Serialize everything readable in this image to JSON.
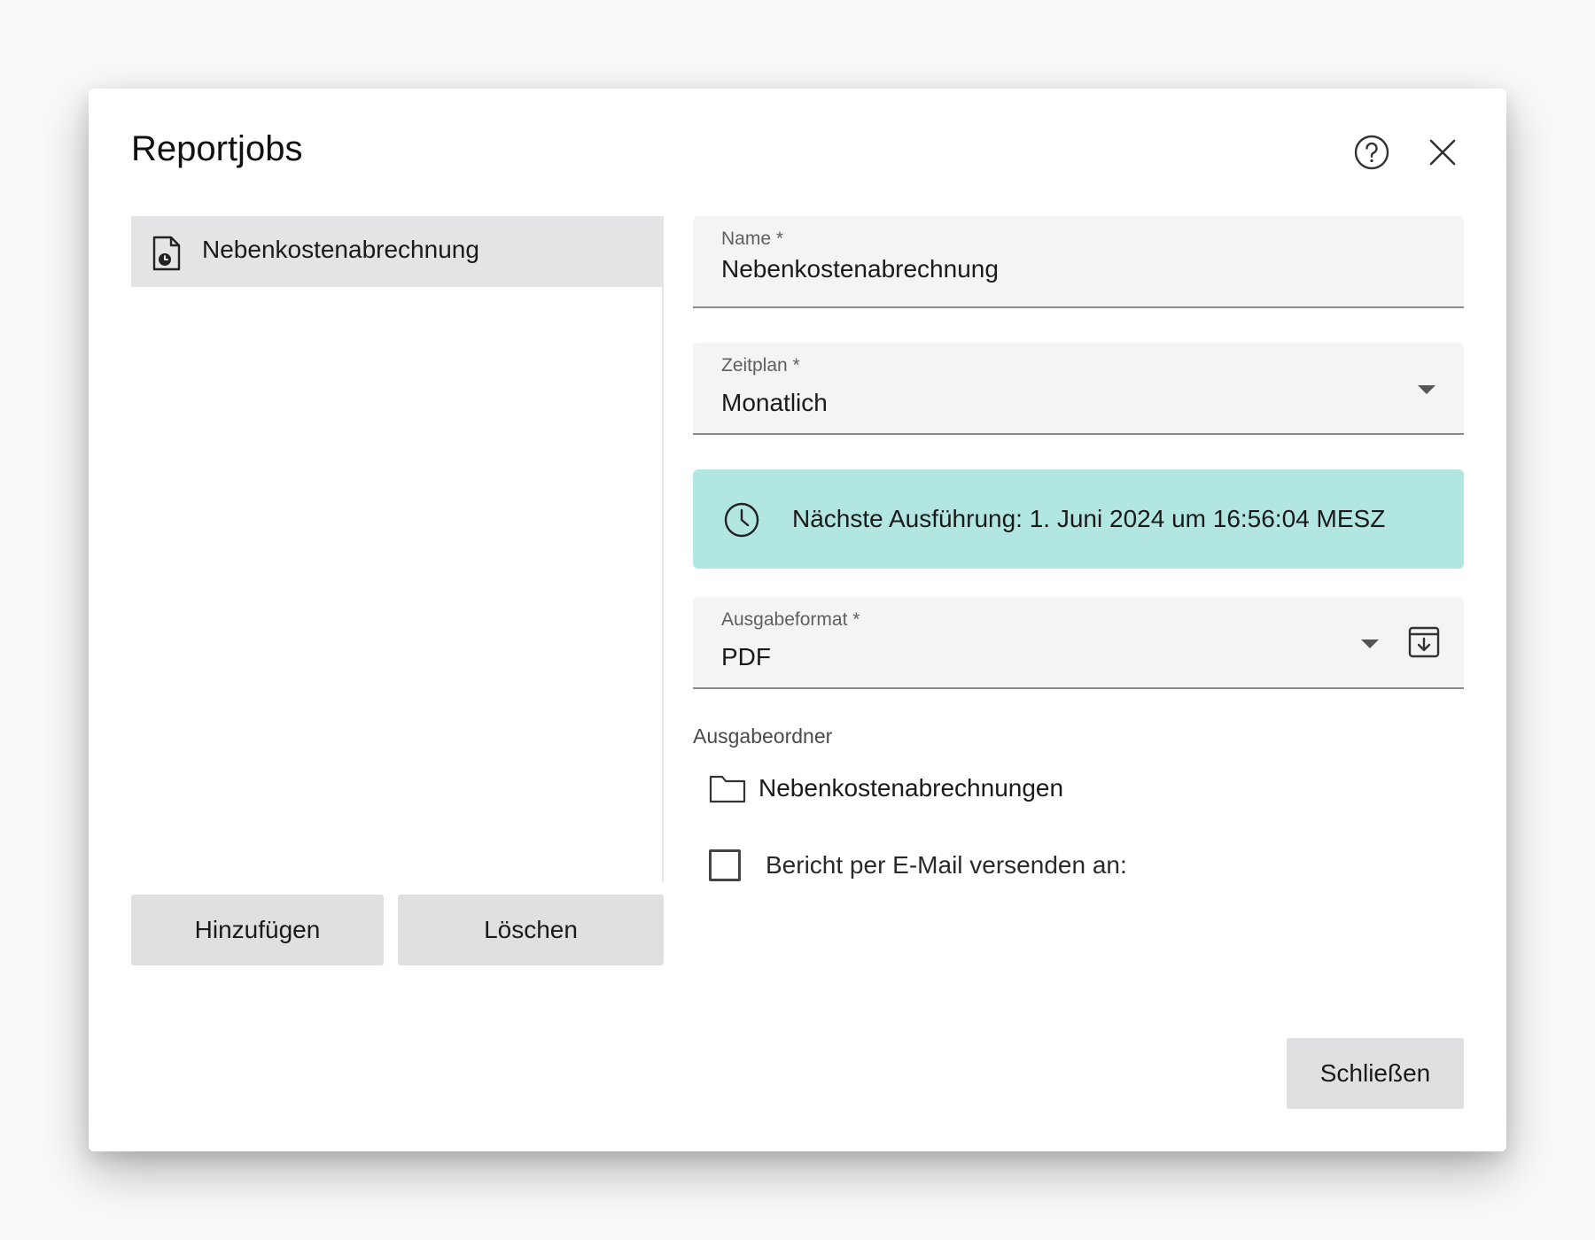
{
  "dialog": {
    "title": "Reportjobs",
    "help_icon": "help-circle-icon",
    "close_icon": "close-icon"
  },
  "job_list": {
    "items": [
      {
        "label": "Nebenkostenabrechnung",
        "icon": "scheduled-document-icon",
        "selected": true
      }
    ],
    "add_label": "Hinzufügen",
    "delete_label": "Löschen"
  },
  "form": {
    "name": {
      "label": "Name *",
      "value": "Nebenkostenabrechnung"
    },
    "schedule": {
      "label": "Zeitplan *",
      "value": "Monatlich",
      "icon": "dropdown-arrow-icon"
    },
    "next_run": {
      "icon": "clock-icon",
      "text": "Nächste Ausführung: 1. Juni 2024 um 16:56:04 MESZ",
      "color": "#b2e6e1"
    },
    "output_format": {
      "label": "Ausgabeformat *",
      "value": "PDF",
      "icon": "download-box-icon"
    },
    "output_folder": {
      "label": "Ausgabeordner",
      "value": "Nebenkostenabrechnungen",
      "icon": "folder-icon"
    },
    "email": {
      "label": "Bericht per E-Mail versenden an:",
      "checked": false
    }
  },
  "footer": {
    "close_label": "Schließen"
  }
}
